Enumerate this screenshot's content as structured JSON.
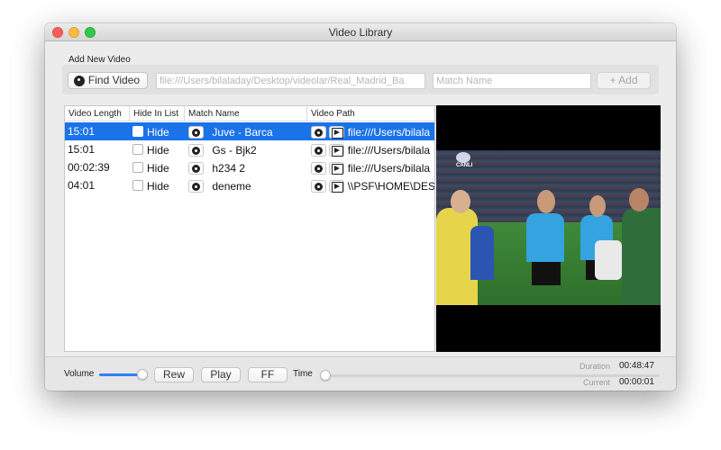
{
  "window": {
    "title": "Video Library"
  },
  "add_section": {
    "label": "Add New Video",
    "find_button": "Find Video",
    "path_placeholder": "file:///Users/bilaladay/Desktop/videolar/Real_Madrid_Ba",
    "match_placeholder": "Match Name",
    "add_button": "+ Add"
  },
  "table": {
    "columns": [
      "Video Length",
      "Hide In List",
      "Match Name",
      "Video Path"
    ],
    "rows": [
      {
        "length": "15:01",
        "hide": "Hide",
        "match": "Juve - Barca",
        "path": "file:///Users/bilala",
        "selected": true
      },
      {
        "length": "15:01",
        "hide": "Hide",
        "match": "Gs - Bjk2",
        "path": "file:///Users/bilala",
        "selected": false
      },
      {
        "length": "00:02:39",
        "hide": "Hide",
        "match": "h234 2",
        "path": "file:///Users/bilala",
        "selected": false
      },
      {
        "length": "04:01",
        "hide": "Hide",
        "match": "deneme",
        "path": "\\\\PSF\\HOME\\DES",
        "selected": false
      }
    ]
  },
  "video": {
    "overlay_text": "CANLI"
  },
  "controls": {
    "volume_label": "Volume",
    "volume_level": 0.9,
    "rew": "Rew",
    "play": "Play",
    "ff": "FF",
    "time_label": "Time",
    "time_position": 0.0,
    "duration_label": "Duration",
    "duration_value": "00:48:47",
    "current_label": "Current",
    "current_value": "00:00:01"
  },
  "colors": {
    "selection": "#1a73e8",
    "slider_fill": "#2f7ff5"
  }
}
